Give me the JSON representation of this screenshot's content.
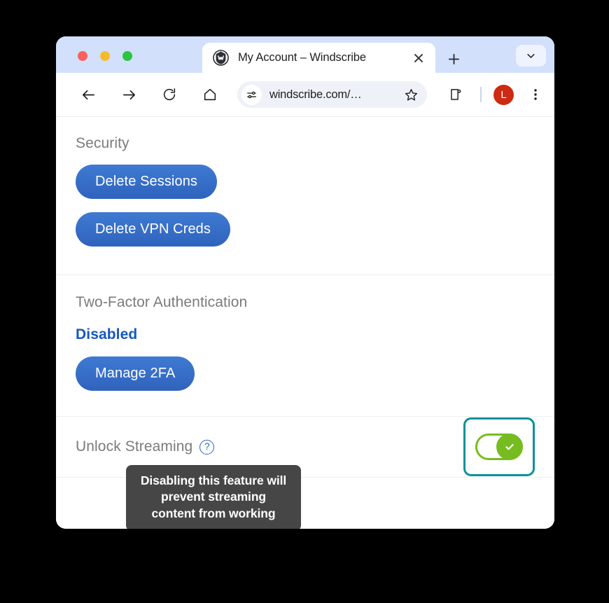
{
  "window": {
    "traffic_lights": [
      "close",
      "minimize",
      "maximize"
    ]
  },
  "tab": {
    "title": "My Account – Windscribe",
    "favicon_name": "windscribe-logo-icon",
    "close_label": "×",
    "new_tab_label": "+",
    "tab_list_chevron": "chevron-down-icon"
  },
  "toolbar": {
    "back": "back-arrow-icon",
    "forward": "forward-arrow-icon",
    "reload": "reload-icon",
    "home": "home-icon",
    "site_settings": "site-settings-icon",
    "url": "windscribe.com/…",
    "bookmark": "star-icon",
    "extensions": "extensions-puzzle-icon",
    "avatar_initial": "L",
    "menu": "three-dot-menu-icon"
  },
  "page": {
    "security": {
      "title": "Security",
      "delete_sessions_label": "Delete Sessions",
      "delete_vpn_creds_label": "Delete VPN Creds"
    },
    "two_factor": {
      "title": "Two-Factor Authentication",
      "status": "Disabled",
      "manage_label": "Manage 2FA"
    },
    "unlock_streaming": {
      "label": "Unlock Streaming",
      "help_glyph": "?",
      "toggle_state": "on",
      "toggle_check_glyph": "✓"
    },
    "tooltip": {
      "text": "Disabling this feature will\nprevent streaming\ncontent from working"
    }
  },
  "colors": {
    "tab_strip_bg": "#d2e0fb",
    "button_blue": "#3b6fc8",
    "status_blue": "#1558c0",
    "toggle_green": "#76bc21",
    "focus_ring_teal": "#0e9199",
    "avatar_red": "#cc2a13",
    "tooltip_bg": "#383838",
    "section_title_gray": "#7b7b7b"
  }
}
